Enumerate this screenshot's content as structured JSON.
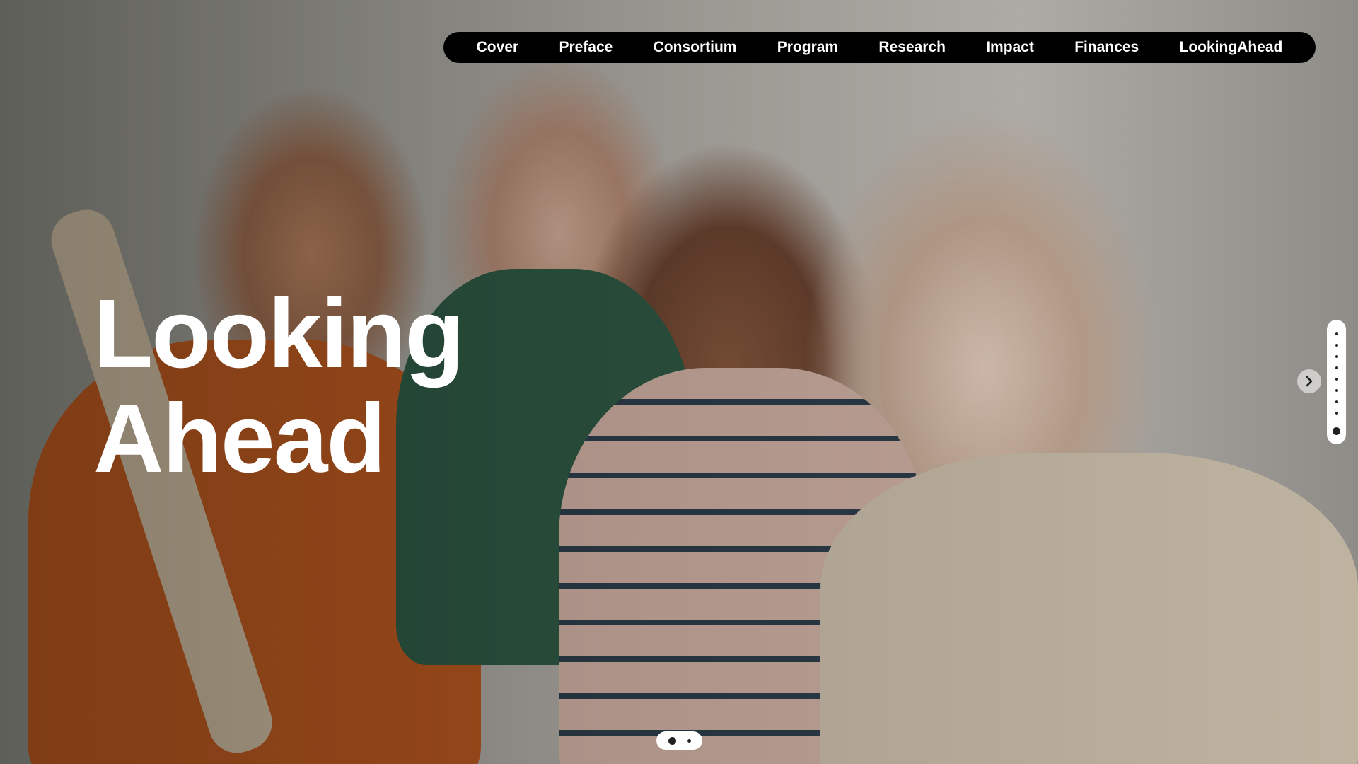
{
  "nav": {
    "items": [
      {
        "label": "Cover"
      },
      {
        "label": "Preface"
      },
      {
        "label": "Consortium"
      },
      {
        "label": "Program"
      },
      {
        "label": "Research"
      },
      {
        "label": "Impact"
      },
      {
        "label": "Finances"
      },
      {
        "label": "LookingAhead"
      }
    ]
  },
  "hero": {
    "title_line1": "Looking",
    "title_line2": "Ahead",
    "image_description_icon": "group-photo-image"
  },
  "controls": {
    "next_icon": "chevron-right-icon",
    "vertical_indicator": {
      "total": 9,
      "active_index": 8
    },
    "bottom_indicator": {
      "total": 2,
      "active_index": 0
    }
  },
  "colors": {
    "nav_background": "#000000",
    "nav_text": "#ffffff",
    "title_text": "#ffffff",
    "indicator_background": "#ffffff"
  }
}
